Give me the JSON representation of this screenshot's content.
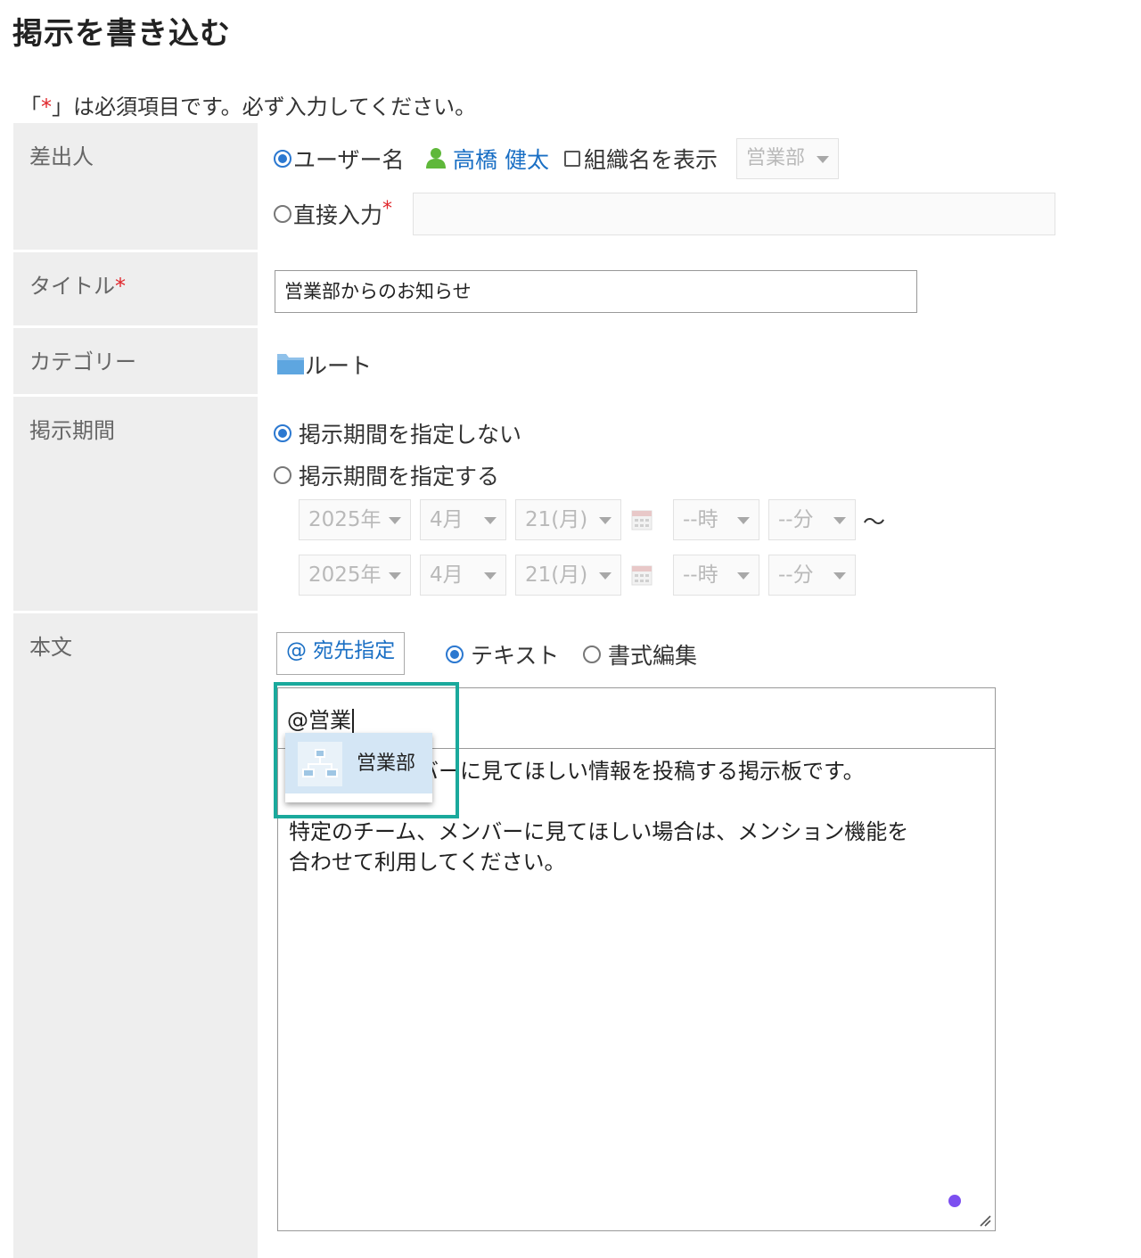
{
  "page": {
    "title": "掲示を書き込む",
    "required_note_prefix": "「",
    "required_note_star": "*",
    "required_note_suffix": "」は必須項目です。必ず入力してください。"
  },
  "sender": {
    "label": "差出人",
    "user_option_label": "ユーザー名",
    "user_name": "高橋 健太",
    "show_org_label": "組織名を表示",
    "org_select_value": "営業部",
    "direct_input_label": "直接入力",
    "required_star": "*",
    "direct_input_value": ""
  },
  "title_field": {
    "label": "タイトル",
    "required_star": "*",
    "value": "営業部からのお知らせ"
  },
  "category": {
    "label": "カテゴリー",
    "value": "ルート"
  },
  "period": {
    "label": "掲示期間",
    "option_no_period": "掲示期間を指定しない",
    "option_set_period": "掲示期間を指定する",
    "start": {
      "year": "2025年",
      "month": "4月",
      "day": "21(月)",
      "hour": "--時",
      "minute": "--分"
    },
    "range_separator": "～",
    "end": {
      "year": "2025年",
      "month": "4月",
      "day": "21(月)",
      "hour": "--時",
      "minute": "--分"
    }
  },
  "body": {
    "label": "本文",
    "mention_button_label": "@ 宛先指定",
    "mode_text_label": "テキスト",
    "mode_rich_label": "書式編集",
    "mention_input_value": "@営業",
    "text": "営業部のメンバーに見てほしい情報を投稿する掲示板です。\n\n特定のチーム、メンバーに見てほしい場合は、メンション機能を\n合わせて利用してください。",
    "suggestion": {
      "label": "営業部",
      "icon": "organization-icon"
    }
  },
  "colors": {
    "accent_blue": "#2b78d0",
    "link_blue": "#1a6fc4",
    "required_red": "#e0262b",
    "highlight_teal": "#1aa99c",
    "label_bg": "#eeeeee"
  }
}
